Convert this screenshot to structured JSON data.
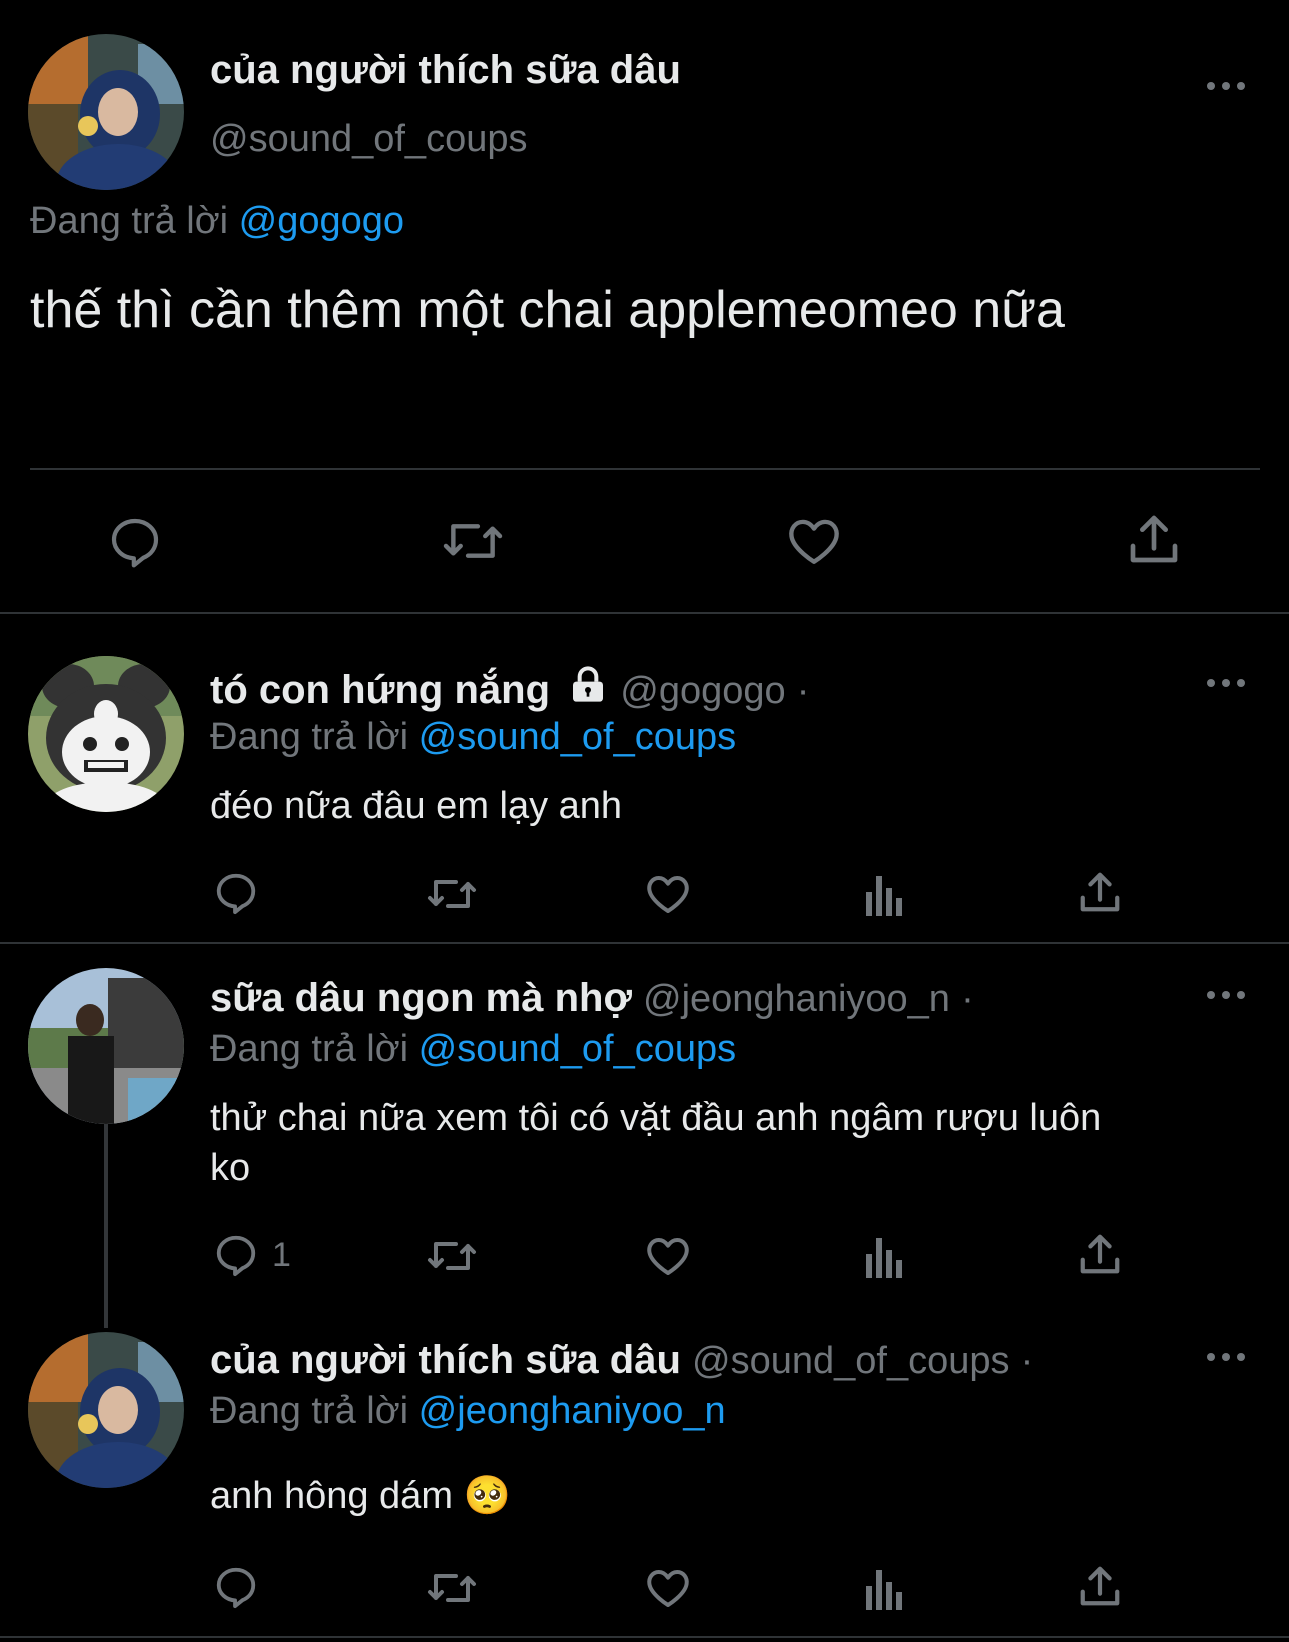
{
  "main_tweet": {
    "display_name": "của người thích sữa dâu",
    "handle": "@sound_of_coups",
    "reply_prefix": "Đang trả lời",
    "reply_to": "@gogogo",
    "text": "thế thì cần thêm một chai applemeomeo nữa"
  },
  "replies": [
    {
      "display_name": "tó con hứng nắng",
      "handle": "@gogogo",
      "separator": "·",
      "reply_prefix": "Đang trả lời",
      "reply_to": "@sound_of_coups",
      "text": "đéo nữa đâu em lạy anh"
    },
    {
      "display_name": "sữa dâu ngon mà nhợ",
      "handle": "@jeonghaniyoo_n",
      "separator": "·",
      "reply_prefix": "Đang trả lời",
      "reply_to": "@sound_of_coups",
      "text_line1": "thử chai nữa xem tôi có vặt đầu anh ngâm rượu luôn",
      "text_line2": "ko",
      "reply_count": "1"
    },
    {
      "display_name": "của người thích sữa dâu",
      "handle": "@sound_of_coups",
      "separator": "·",
      "reply_prefix": "Đang trả lời",
      "reply_to": "@jeonghaniyoo_n",
      "text": "anh hông dám",
      "emoji": "🥺"
    }
  ],
  "icons": [
    "reply-icon",
    "retweet-icon",
    "like-icon",
    "views-icon",
    "share-icon",
    "more-icon",
    "lock-icon"
  ],
  "colors": {
    "background": "#000000",
    "text": "#e7e9ea",
    "secondary": "#71767b",
    "link": "#1d9bf0",
    "divider": "#2f3336"
  }
}
